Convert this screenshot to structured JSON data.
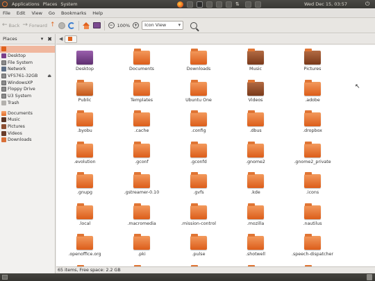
{
  "top_panel": {
    "menus": [
      "Applications",
      "Places",
      "System"
    ],
    "clock": "Wed Dec 15, 03:57",
    "power": "⏻"
  },
  "window": {
    "menubar": [
      "File",
      "Edit",
      "View",
      "Go",
      "Bookmarks",
      "Help"
    ],
    "toolbar": {
      "back_label": "Back",
      "forward_label": "Forward",
      "zoom_level": "100%",
      "view_mode": "Icon View"
    },
    "sidebar": {
      "header": "Places",
      "items": [
        {
          "label": "",
          "icon": "home-icon",
          "selected": true
        },
        {
          "label": "Desktop",
          "icon": "desktop-icon"
        },
        {
          "label": "File System",
          "icon": "disk-icon"
        },
        {
          "label": "Network",
          "icon": "network-icon"
        },
        {
          "label": "VFS761-32GB",
          "icon": "usb-drive-icon",
          "eject": true
        },
        {
          "label": "WindowsXP",
          "icon": "disk-icon"
        },
        {
          "label": "Floppy Drive",
          "icon": "floppy-icon"
        },
        {
          "label": "U3 System",
          "icon": "disk-icon"
        },
        {
          "label": "Trash",
          "icon": "trash-icon"
        }
      ],
      "bookmarks": [
        {
          "label": "Documents",
          "icon": "folder-icon"
        },
        {
          "label": "Music",
          "icon": "music-folder-icon"
        },
        {
          "label": "Pictures",
          "icon": "pictures-folder-icon"
        },
        {
          "label": "Videos",
          "icon": "videos-folder-icon"
        },
        {
          "label": "Downloads",
          "icon": "downloads-folder-icon"
        }
      ]
    },
    "location": {
      "path_button": ""
    },
    "files": [
      "Desktop",
      "Documents",
      "Downloads",
      "Music",
      "Pictures",
      "Public",
      "Templates",
      "Ubuntu One",
      "Videos",
      ".adobe",
      ".byobu",
      ".cache",
      ".config",
      ".dbus",
      ".dropbox",
      ".evolution",
      ".gconf",
      ".gconfd",
      ".gnome2",
      ".gnome2_private",
      ".gnupg",
      ".gstreamer-0.10",
      ".gvfs",
      ".kde",
      ".icons",
      ".local",
      ".macromedia",
      ".mission-control",
      ".mozilla",
      ".nautilus",
      ".openoffice.org",
      ".pki",
      ".pulse",
      ".shotwell",
      ".speech-dispatcher",
      "",
      "",
      "",
      "",
      ""
    ],
    "status": "65 items, Free space: 2.2 GB"
  }
}
